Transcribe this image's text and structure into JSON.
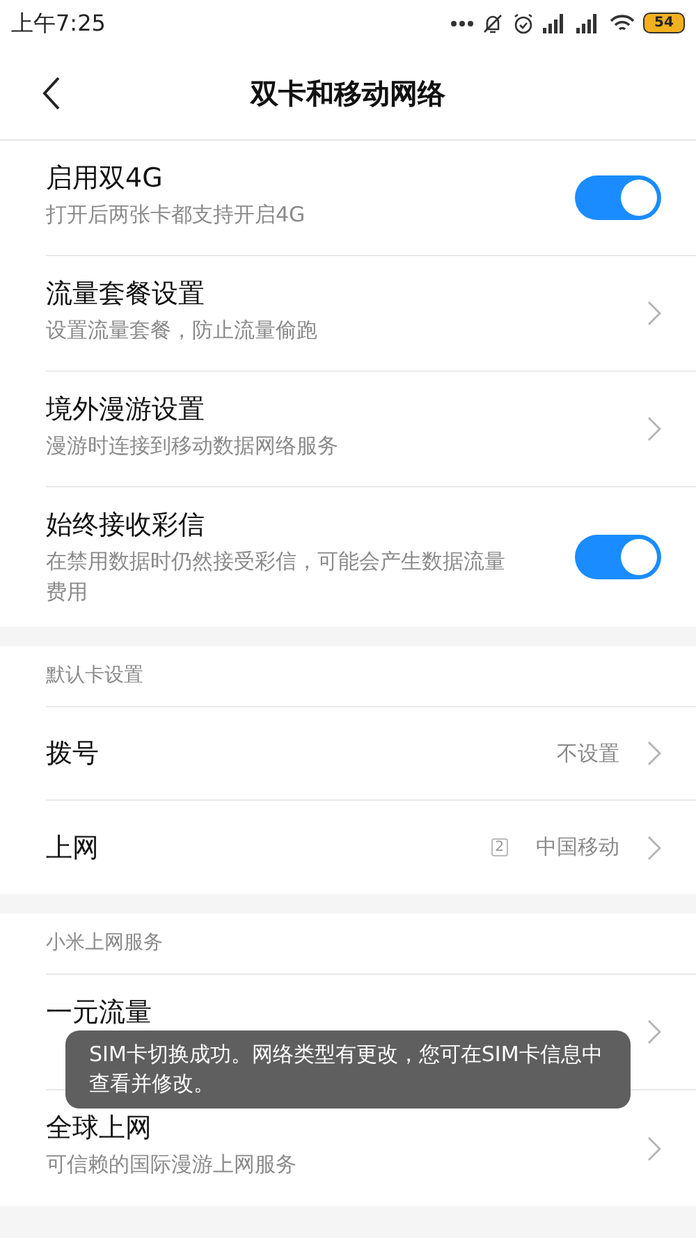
{
  "status_bar": {
    "time": "上午7:25",
    "battery": "54"
  },
  "header": {
    "title": "双卡和移动网络"
  },
  "sections": [
    {
      "items": [
        {
          "kind": "switch",
          "title": "启用双4G",
          "subtitle": "打开后两张卡都支持开启4G",
          "on": true
        },
        {
          "kind": "link",
          "title": "流量套餐设置",
          "subtitle": "设置流量套餐，防止流量偷跑"
        },
        {
          "kind": "link",
          "title": "境外漫游设置",
          "subtitle": "漫游时连接到移动数据网络服务"
        },
        {
          "kind": "switch",
          "title": "始终接收彩信",
          "subtitle": "在禁用数据时仍然接受彩信，可能会产生数据流量费用",
          "on": true
        }
      ]
    },
    {
      "heading": "默认卡设置",
      "items": [
        {
          "kind": "link",
          "title": "拨号",
          "value": "不设置"
        },
        {
          "kind": "link",
          "title": "上网",
          "sim": "2",
          "value": "中国移动"
        }
      ]
    },
    {
      "heading": "小米上网服务",
      "items": [
        {
          "kind": "link",
          "title": "一元流量"
        },
        {
          "kind": "link",
          "title": "全球上网",
          "subtitle": "可信赖的国际漫游上网服务"
        }
      ]
    }
  ],
  "toast": {
    "text": "SIM卡切换成功。网络类型有更改，您可在SIM卡信息中查看并修改。"
  }
}
